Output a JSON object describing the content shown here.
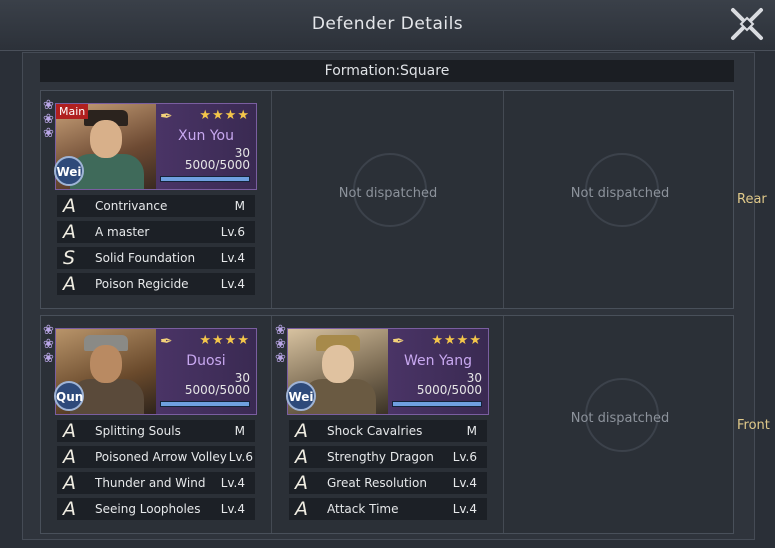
{
  "header": {
    "title": "Defender Details"
  },
  "formation_label": "Formation:Square",
  "row_labels": {
    "rear": "Rear",
    "front": "Front"
  },
  "empty_slot_text": "Not dispatched",
  "rear": {
    "slot1": {
      "main_tag": "Main",
      "name": "Xun You",
      "faction": "Wei",
      "stars": "★★★★",
      "level": "30",
      "troops": "5000/5000",
      "troop_fraction": 1.0,
      "skills": [
        {
          "grade": "A",
          "name": "Contrivance",
          "level": "M"
        },
        {
          "grade": "A",
          "name": "A master",
          "level": "Lv.6"
        },
        {
          "grade": "S",
          "name": "Solid Foundation",
          "level": "Lv.4"
        },
        {
          "grade": "A",
          "name": "Poison Regicide",
          "level": "Lv.4"
        }
      ]
    }
  },
  "front": {
    "slot1": {
      "name": "Duosi",
      "faction": "Qun",
      "stars": "★★★★",
      "level": "30",
      "troops": "5000/5000",
      "troop_fraction": 1.0,
      "skills": [
        {
          "grade": "A",
          "name": "Splitting Souls",
          "level": "M"
        },
        {
          "grade": "A",
          "name": "Poisoned Arrow Volley",
          "level": "Lv.6"
        },
        {
          "grade": "A",
          "name": "Thunder and Wind",
          "level": "Lv.4"
        },
        {
          "grade": "A",
          "name": "Seeing Loopholes",
          "level": "Lv.4"
        }
      ]
    },
    "slot2": {
      "name": "Wen Yang",
      "faction": "Wei",
      "stars": "★★★★",
      "level": "30",
      "troops": "5000/5000",
      "troop_fraction": 1.0,
      "skills": [
        {
          "grade": "A",
          "name": "Shock Cavalries",
          "level": "M"
        },
        {
          "grade": "A",
          "name": "Strengthy Dragon",
          "level": "Lv.6"
        },
        {
          "grade": "A",
          "name": "Great Resolution",
          "level": "Lv.4"
        },
        {
          "grade": "A",
          "name": "Attack Time",
          "level": "Lv.4"
        }
      ]
    }
  },
  "icons": {
    "close": "close-x-icon",
    "feather": "feather-icon",
    "flower": "flower-ornament-icon"
  },
  "colors": {
    "star": "#f4c64a",
    "name": "#c8a8f0",
    "row_label": "#e0c98a",
    "main_tag": "#b0201f"
  }
}
